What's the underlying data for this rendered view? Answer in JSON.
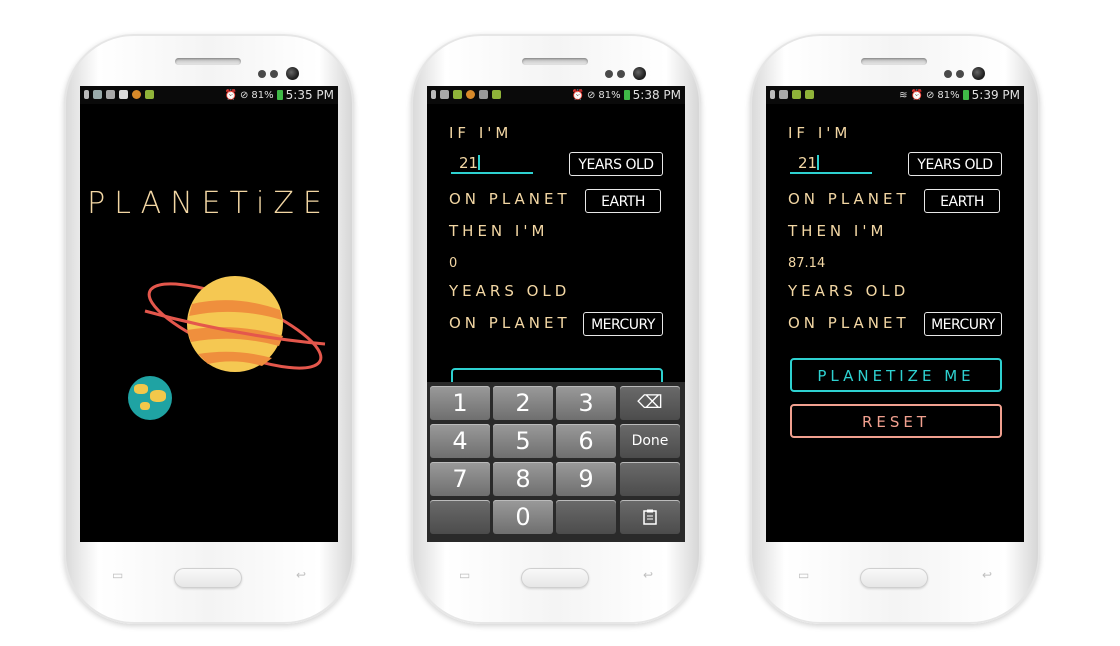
{
  "phones": [
    {
      "status": {
        "battery": "81%",
        "time": "5:35 PM"
      },
      "app": {
        "logo_text": "PLANETiZE"
      }
    },
    {
      "status": {
        "battery": "81%",
        "time": "5:38 PM"
      },
      "form": {
        "if_label": "IF I'M",
        "age_value": "21",
        "years_old_button": "YEARS OLD",
        "on_planet_label": "ON PLANET",
        "planet_from": "EARTH",
        "then_label": "THEN I'M",
        "result_value": "0",
        "years_old_label": "YEARS OLD",
        "on_planet_label_2": "ON PLANET",
        "planet_to": "MERCURY"
      },
      "keypad": {
        "keys": [
          "1",
          "2",
          "3",
          "⌫",
          "4",
          "5",
          "6",
          "Done",
          "7",
          "8",
          "9",
          "",
          "",
          "0",
          "",
          ""
        ],
        "done_label": "Done"
      }
    },
    {
      "status": {
        "battery": "81%",
        "time": "5:39 PM"
      },
      "form": {
        "if_label": "IF I'M",
        "age_value": "21",
        "years_old_button": "YEARS OLD",
        "on_planet_label": "ON PLANET",
        "planet_from": "EARTH",
        "then_label": "THEN I'M",
        "result_value": "87.14",
        "years_old_label": "YEARS OLD",
        "on_planet_label_2": "ON PLANET",
        "planet_to": "MERCURY",
        "planetize_button": "PLANETIZE ME",
        "reset_button": "RESET"
      }
    }
  ],
  "colors": {
    "accent_teal": "#2ed1d0",
    "label_cream": "#f3d7a4",
    "reset_salmon": "#f1a08f",
    "screen_bg": "#000000"
  }
}
